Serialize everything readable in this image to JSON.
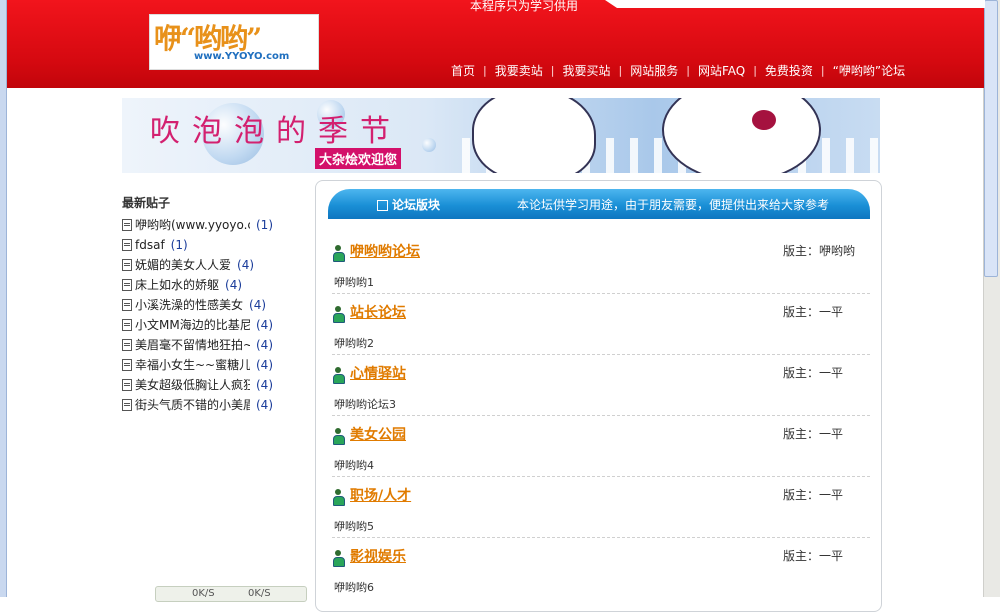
{
  "header": {
    "notice": "本程序只为学习供用",
    "logo_main": "咿“哟哟”",
    "logo_url": "www.YYOYO.com",
    "nav": [
      {
        "label": "首页"
      },
      {
        "label": "我要卖站"
      },
      {
        "label": "我要买站"
      },
      {
        "label": "网站服务"
      },
      {
        "label": "网站FAQ"
      },
      {
        "label": "免费投资"
      },
      {
        "label": "“咿哟哟”论坛"
      }
    ]
  },
  "banner": {
    "title": "吹泡泡的季节",
    "subtitle": "大杂烩欢迎您"
  },
  "sidebar": {
    "title": "最新贴子",
    "posts": [
      {
        "title": "咿哟哟(www.yyoyo.co",
        "count": "(1)"
      },
      {
        "title": "fdsaf",
        "count": "(1)"
      },
      {
        "title": "妩媚的美女人人爱",
        "count": "(4)"
      },
      {
        "title": "床上如水的娇躯",
        "count": "(4)"
      },
      {
        "title": "小溪洗澡的性感美女",
        "count": "(4)"
      },
      {
        "title": "小文MM海边的比基尼",
        "count": "(4)"
      },
      {
        "title": "美眉毫不留情地狂拍~",
        "count": "(4)"
      },
      {
        "title": "幸福小女生~~蜜糖儿~~",
        "count": "(4)"
      },
      {
        "title": "美女超级低胸让人疯狂",
        "count": "(4)"
      },
      {
        "title": "街头气质不错的小美眉",
        "count": "(4)"
      }
    ]
  },
  "statusbar": {
    "left": "0K/S",
    "right": "0K/S"
  },
  "panel": {
    "title": "论坛版块",
    "description": "本论坛供学习用途，由于朋友需要，便提供出来给大家参考"
  },
  "forums": [
    {
      "name": "咿哟哟论坛",
      "moderator": "版主：咿哟哟",
      "desc": "咿哟哟1"
    },
    {
      "name": "站长论坛",
      "moderator": "版主：一平",
      "desc": "咿哟哟2"
    },
    {
      "name": "心情驿站",
      "moderator": "版主：一平",
      "desc": "咿哟哟论坛3"
    },
    {
      "name": "美女公园",
      "moderator": "版主：一平",
      "desc": "咿哟哟4"
    },
    {
      "name": "职场/人才",
      "moderator": "版主：一平",
      "desc": "咿哟哟5"
    },
    {
      "name": "影视娱乐",
      "moderator": "版主：一平",
      "desc": "咿哟哟6"
    }
  ]
}
